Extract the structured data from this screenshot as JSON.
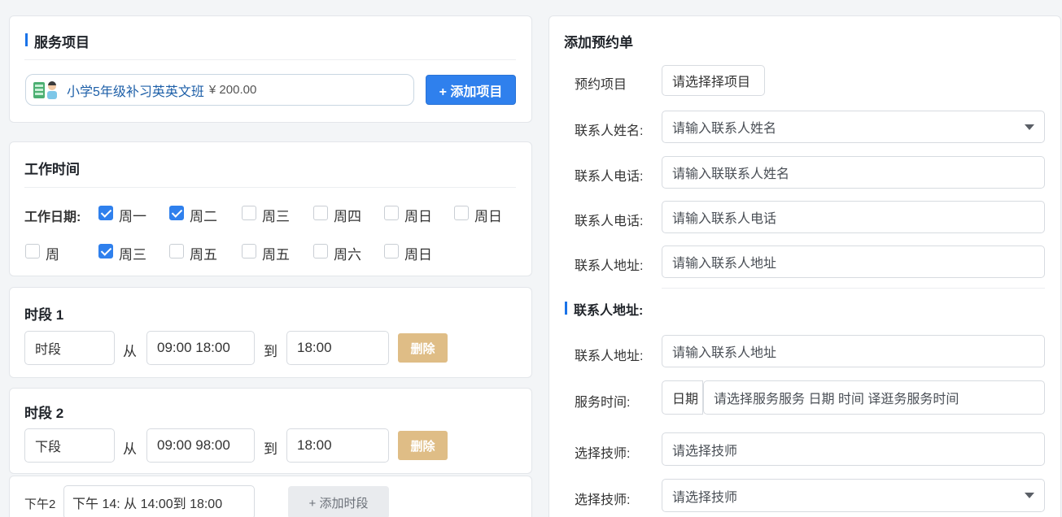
{
  "service": {
    "title": "服务项目",
    "item_name": "小学5年级补习英英文班",
    "item_price": "¥ 200.00",
    "add_button": "+ 添加项目"
  },
  "work_time": {
    "title": "工作时间",
    "days_label": "工作日期:",
    "days": [
      {
        "label": "周一",
        "checked": true
      },
      {
        "label": "周二",
        "checked": true
      },
      {
        "label": "周三",
        "checked": false
      },
      {
        "label": "周四",
        "checked": false
      },
      {
        "label": "周日",
        "checked": false
      },
      {
        "label": "周日",
        "checked": false
      },
      {
        "label": "周",
        "checked": false
      },
      {
        "label": "周三",
        "checked": true
      },
      {
        "label": "周五",
        "checked": false
      },
      {
        "label": "周五",
        "checked": false
      },
      {
        "label": "周六",
        "checked": false
      },
      {
        "label": "周日",
        "checked": false
      }
    ]
  },
  "slot1": {
    "title": "时段 1",
    "name": "时段",
    "from_label": "从",
    "from_value": "09:00  18:00",
    "to_label": "到",
    "to_value": "18:00",
    "delete": "删除"
  },
  "slot2": {
    "title": "时段 2",
    "name": "下段",
    "from_label": "从",
    "from_value": "09:00  98:00",
    "to_label": "到",
    "to_value": "18:00",
    "delete": "删除"
  },
  "slot3": {
    "label": "下午2",
    "value": "下午 14: 从  14:00到 18:00",
    "add_button": "+ 添加时段"
  },
  "booking": {
    "title": "添加预约单",
    "project_label": "预约项目",
    "project_button": "请选择择项目",
    "name_label": "联系人姓名:",
    "name_placeholder": "请输入联系人姓名",
    "phone1_label": "联系人电话:",
    "phone1_placeholder": "请输入联联系人姓名",
    "phone2_label": "联系人电话:",
    "phone2_placeholder": "请输入联系人电话",
    "address_label": "联系人地址:",
    "address_placeholder": "请输入联系人地址",
    "section2_title": "联系人地址:",
    "address2_label": "联系人地址:",
    "address2_placeholder": "请输入联系人地址",
    "service_time_label": "服务时间:",
    "service_time_prefix": "日期",
    "service_time_placeholder": "请选择服务服务  日期   时间  译逛务服务时间",
    "tech1_label": "选择技师:",
    "tech1_placeholder": "请选择技师",
    "tech2_label": "选择技师:",
    "tech2_placeholder": "请选择技师"
  }
}
